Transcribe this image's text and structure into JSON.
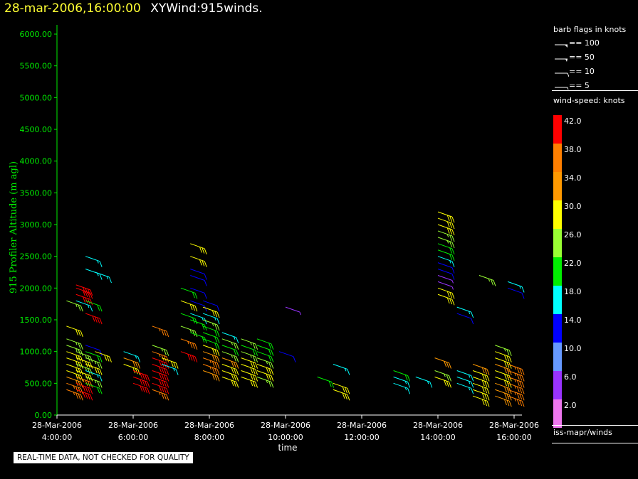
{
  "header": {
    "date_label": "28-mar-2006,16:00:00",
    "title": "XYWind:915winds."
  },
  "quality_note": "REAL-TIME DATA, NOT CHECKED FOR QUALITY",
  "legend": {
    "flags_title": "barb flags in knots",
    "flags": [
      {
        "label": "== 100"
      },
      {
        "label": "== 50"
      },
      {
        "label": "== 10"
      },
      {
        "label": "== 5"
      }
    ],
    "speed_title": "wind-speed: knots",
    "speed_scale": [
      {
        "label": "42.0",
        "color": "#ff0000"
      },
      {
        "label": "38.0",
        "color": "#ff7f00"
      },
      {
        "label": "34.0",
        "color": "#ff9900"
      },
      {
        "label": "30.0",
        "color": "#ffff00"
      },
      {
        "label": "26.0",
        "color": "#99ff33"
      },
      {
        "label": "22.0",
        "color": "#00ee00"
      },
      {
        "label": "18.0",
        "color": "#00ffff"
      },
      {
        "label": "14.0",
        "color": "#0000ff"
      },
      {
        "label": "10.0",
        "color": "#6699ff"
      },
      {
        "label": "6.0",
        "color": "#9933ff"
      },
      {
        "label": "2.0",
        "color": "#ee77ee"
      }
    ],
    "source": "iss-mapr/winds"
  },
  "chart_data": {
    "type": "wind-barb",
    "title": "28-mar-2006,16:00:00  XYWind:915winds.",
    "xlabel": "time",
    "ylabel": "915 Profiler Altitude (m agl)",
    "ylim": [
      0,
      6200
    ],
    "xlim": [
      "28-Mar-2006 04:00:00",
      "28-Mar-2006 16:10:00"
    ],
    "grid": false,
    "legend_placement": "right",
    "y_ticks": [
      "0.00",
      "500.00",
      "1000.00",
      "1500.00",
      "2000.00",
      "2500.00",
      "3000.00",
      "3500.00",
      "4000.00",
      "4500.00",
      "5000.00",
      "5500.00",
      "6000.00"
    ],
    "x_ticks": [
      {
        "date": "28-Mar-2006",
        "time": "4:00:00"
      },
      {
        "date": "28-Mar-2006",
        "time": "6:00:00"
      },
      {
        "date": "28-Mar-2006",
        "time": "8:00:00"
      },
      {
        "date": "28-Mar-2006",
        "time": "10:00:00"
      },
      {
        "date": "28-Mar-2006",
        "time": "12:00:00"
      },
      {
        "date": "28-Mar-2006",
        "time": "14:00:00"
      },
      {
        "date": "28-Mar-2006",
        "time": "16:00:00"
      }
    ],
    "profiles": [
      {
        "time": "04:15",
        "obs": [
          [
            400,
            38
          ],
          [
            500,
            38
          ],
          [
            600,
            34
          ],
          [
            700,
            30
          ],
          [
            800,
            30
          ],
          [
            900,
            30
          ],
          [
            1000,
            30
          ],
          [
            1100,
            26
          ],
          [
            1200,
            26
          ],
          [
            1400,
            30
          ],
          [
            1800,
            26
          ]
        ]
      },
      {
        "time": "04:30",
        "obs": [
          [
            400,
            42
          ],
          [
            500,
            42
          ],
          [
            600,
            38
          ],
          [
            700,
            30
          ],
          [
            800,
            26
          ],
          [
            900,
            30
          ],
          [
            1000,
            26
          ],
          [
            1800,
            18
          ],
          [
            1900,
            42
          ],
          [
            2000,
            42
          ],
          [
            2050,
            42
          ]
        ]
      },
      {
        "time": "04:45",
        "obs": [
          [
            500,
            22
          ],
          [
            600,
            26
          ],
          [
            700,
            18
          ],
          [
            800,
            30
          ],
          [
            900,
            26
          ],
          [
            1000,
            22
          ],
          [
            1100,
            14
          ],
          [
            1600,
            42
          ],
          [
            1800,
            22
          ],
          [
            2300,
            18
          ],
          [
            2500,
            18
          ]
        ]
      },
      {
        "time": "05:00",
        "obs": [
          [
            1000,
            30
          ],
          [
            2250,
            18
          ]
        ]
      },
      {
        "time": "05:45",
        "obs": [
          [
            800,
            30
          ],
          [
            900,
            34
          ],
          [
            1000,
            18
          ]
        ]
      },
      {
        "time": "06:00",
        "obs": [
          [
            500,
            42
          ],
          [
            600,
            42
          ],
          [
            700,
            42
          ]
        ]
      },
      {
        "time": "06:30",
        "obs": [
          [
            400,
            38
          ],
          [
            500,
            42
          ],
          [
            600,
            42
          ],
          [
            700,
            42
          ],
          [
            800,
            42
          ],
          [
            900,
            42
          ],
          [
            1000,
            38
          ],
          [
            1100,
            26
          ],
          [
            1400,
            38
          ]
        ]
      },
      {
        "time": "06:45",
        "obs": [
          [
            800,
            18
          ],
          [
            900,
            30
          ]
        ]
      },
      {
        "time": "07:15",
        "obs": [
          [
            1000,
            42
          ],
          [
            1200,
            38
          ],
          [
            1400,
            26
          ],
          [
            1600,
            22
          ],
          [
            1800,
            30
          ],
          [
            2000,
            22
          ]
        ]
      },
      {
        "time": "07:30",
        "obs": [
          [
            1300,
            22
          ],
          [
            1500,
            22
          ],
          [
            1600,
            18
          ],
          [
            1800,
            14
          ],
          [
            2000,
            14
          ],
          [
            2200,
            14
          ],
          [
            2300,
            14
          ],
          [
            2500,
            30
          ],
          [
            2700,
            30
          ]
        ]
      },
      {
        "time": "07:50",
        "obs": [
          [
            700,
            34
          ],
          [
            800,
            38
          ],
          [
            900,
            38
          ],
          [
            1000,
            34
          ],
          [
            1100,
            30
          ],
          [
            1200,
            22
          ],
          [
            1300,
            22
          ],
          [
            1400,
            22
          ],
          [
            1500,
            26
          ],
          [
            1600,
            18
          ],
          [
            1700,
            30
          ],
          [
            1800,
            14
          ]
        ]
      },
      {
        "time": "08:20",
        "obs": [
          [
            600,
            30
          ],
          [
            700,
            30
          ],
          [
            800,
            30
          ],
          [
            900,
            34
          ],
          [
            1000,
            26
          ],
          [
            1100,
            22
          ],
          [
            1200,
            26
          ],
          [
            1300,
            18
          ]
        ]
      },
      {
        "time": "08:50",
        "obs": [
          [
            600,
            30
          ],
          [
            700,
            30
          ],
          [
            800,
            30
          ],
          [
            900,
            30
          ],
          [
            1000,
            26
          ],
          [
            1100,
            22
          ],
          [
            1200,
            26
          ]
        ]
      },
      {
        "time": "09:15",
        "obs": [
          [
            600,
            26
          ],
          [
            700,
            30
          ],
          [
            800,
            30
          ],
          [
            900,
            26
          ],
          [
            1000,
            22
          ],
          [
            1100,
            22
          ],
          [
            1200,
            22
          ]
        ]
      },
      {
        "time": "09:50",
        "obs": [
          [
            1000,
            14
          ]
        ]
      },
      {
        "time": "10:00",
        "obs": [
          [
            1700,
            6
          ]
        ]
      },
      {
        "time": "10:50",
        "obs": [
          [
            600,
            22
          ]
        ]
      },
      {
        "time": "11:15",
        "obs": [
          [
            400,
            30
          ],
          [
            500,
            30
          ],
          [
            800,
            18
          ]
        ]
      },
      {
        "time": "12:50",
        "obs": [
          [
            500,
            18
          ],
          [
            600,
            18
          ],
          [
            700,
            22
          ]
        ]
      },
      {
        "time": "13:25",
        "obs": [
          [
            600,
            18
          ]
        ]
      },
      {
        "time": "13:55",
        "obs": [
          [
            600,
            30
          ],
          [
            700,
            26
          ],
          [
            900,
            34
          ]
        ]
      },
      {
        "time": "14:00",
        "obs": [
          [
            1900,
            30
          ],
          [
            2000,
            30
          ],
          [
            2100,
            6
          ],
          [
            2200,
            6
          ],
          [
            2300,
            14
          ],
          [
            2400,
            14
          ],
          [
            2500,
            18
          ],
          [
            2600,
            22
          ],
          [
            2700,
            22
          ],
          [
            2800,
            26
          ],
          [
            2900,
            26
          ],
          [
            3000,
            30
          ],
          [
            3100,
            30
          ],
          [
            3200,
            30
          ]
        ]
      },
      {
        "time": "14:30",
        "obs": [
          [
            500,
            18
          ],
          [
            600,
            18
          ],
          [
            700,
            18
          ],
          [
            1600,
            14
          ],
          [
            1700,
            18
          ]
        ]
      },
      {
        "time": "14:55",
        "obs": [
          [
            300,
            30
          ],
          [
            400,
            30
          ],
          [
            500,
            30
          ],
          [
            600,
            30
          ],
          [
            700,
            30
          ],
          [
            800,
            34
          ]
        ]
      },
      {
        "time": "15:05",
        "obs": [
          [
            2200,
            26
          ]
        ]
      },
      {
        "time": "15:30",
        "obs": [
          [
            300,
            34
          ],
          [
            400,
            34
          ],
          [
            500,
            34
          ],
          [
            600,
            30
          ],
          [
            700,
            30
          ],
          [
            800,
            34
          ],
          [
            900,
            30
          ],
          [
            1000,
            30
          ],
          [
            1100,
            26
          ]
        ]
      },
      {
        "time": "15:50",
        "obs": [
          [
            300,
            38
          ],
          [
            400,
            38
          ],
          [
            500,
            38
          ],
          [
            600,
            38
          ],
          [
            700,
            38
          ],
          [
            800,
            38
          ],
          [
            2000,
            14
          ],
          [
            2100,
            18
          ]
        ]
      }
    ]
  }
}
